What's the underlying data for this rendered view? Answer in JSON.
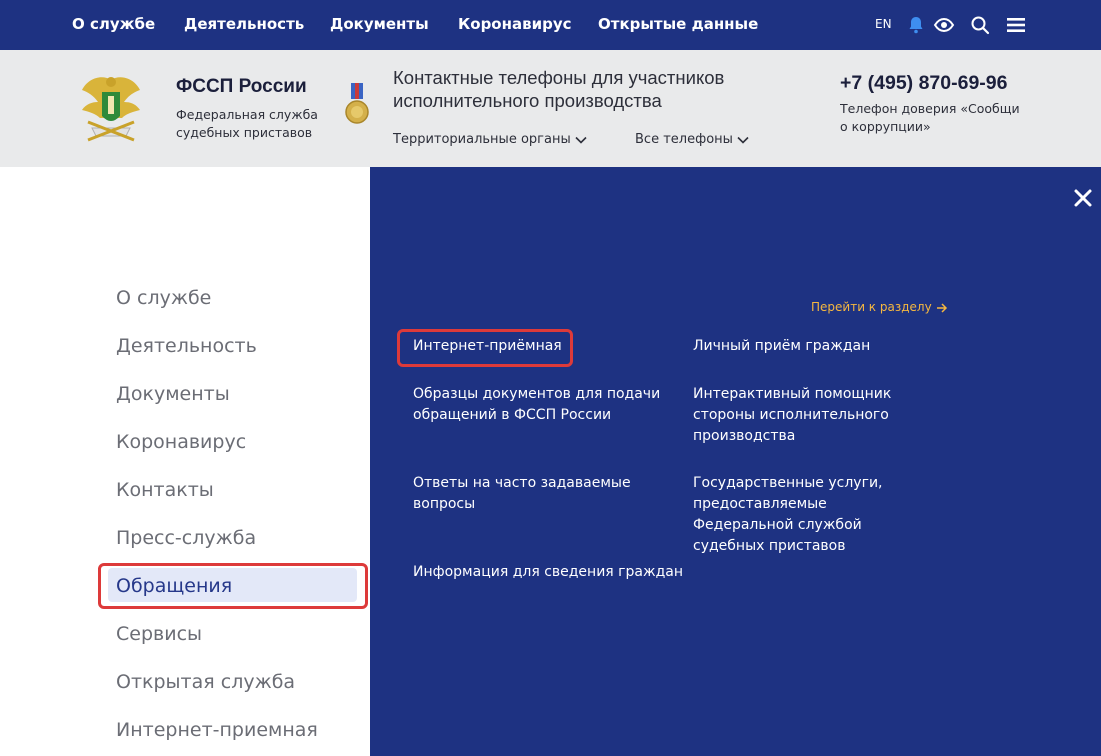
{
  "topnav": {
    "items": [
      "О службе",
      "Деятельность",
      "Документы",
      "Коронавирус",
      "Открытые данные"
    ],
    "lang": "EN",
    "icons": [
      "bell-icon",
      "eye-icon",
      "search-icon",
      "menu-icon"
    ]
  },
  "header": {
    "brand_title": "ФССП России",
    "brand_subtitle": "Федеральная служба судебных приставов",
    "contacts_title": "Контактные телефоны для участников исполнительного производства",
    "dropdown_territorial": "Территориальные органы",
    "dropdown_all_phones": "Все телефоны",
    "phone": "+7 (495) 870-69-96",
    "hotline": "Телефон доверия «Сообщи о коррупции»"
  },
  "left_menu": {
    "items": [
      "О службе",
      "Деятельность",
      "Документы",
      "Коронавирус",
      "Контакты",
      "Пресс-служба",
      "Обращения",
      "Сервисы",
      "Открытая служба",
      "Интернет-приемная"
    ],
    "active_index": 6
  },
  "panel": {
    "goto_label": "Перейти к разделу",
    "links_left": [
      "Интернет-приёмная",
      "Образцы документов для подачи обращений в ФССП России",
      "Ответы на часто задаваемые вопросы",
      "Информация для сведения граждан"
    ],
    "links_right": [
      "Личный приём граждан",
      "Интерактивный помощник стороны исполнительного производства",
      "Государственные услуги, предоставляемые Федеральной службой судебных приставов"
    ]
  },
  "colors": {
    "nav_blue": "#1e3282",
    "header_gray": "#e9eaeb",
    "accent_yellow": "#f5b740",
    "highlight_red": "#dd3a3a"
  }
}
